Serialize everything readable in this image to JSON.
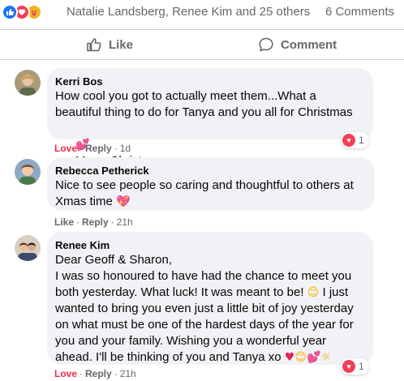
{
  "reactions": {
    "types": [
      "like-icon",
      "love-icon",
      "care-icon"
    ],
    "reactors_text": "Natalie Landsberg, Renee Kim and 25 others",
    "comments_count": "6 Comments"
  },
  "actions": {
    "like_label": "Like",
    "comment_label": "Comment"
  },
  "comments": [
    {
      "author": "Kerri Bos",
      "text": "How cool you got to actually meet them...What a\nbeautiful thing to do for Tanya and you all for Christmas",
      "text_line2": "Merry Christmas",
      "action_1": "Love",
      "action_2": "Reply",
      "time": "1d",
      "reaction_count": "1"
    },
    {
      "author": "Rebecca Petherick",
      "text": "Nice to see people so caring and thoughtful to others at\nXmas time",
      "action_1": "Like",
      "action_2": "Reply",
      "time": "21h"
    },
    {
      "author": "Renee Kim",
      "text_a": "Dear Geoff & Sharon,\nI was so honoured to have had the chance to meet you\nboth yesterday. What luck! It was meant to be!",
      "text_b": " I just\nwanted to bring you even just a little bit of joy yesterday\non what must be one of the hardest days of the year for\nyou and your family. Wishing you a wonderful year\nahead. I'll be thinking of you and Tanya xo ",
      "action_1": "Love",
      "action_2": "Reply",
      "time": "21h",
      "reaction_count": "1"
    }
  ],
  "colors": {
    "accent": "#1877f2",
    "love": "#f33e58",
    "muted": "#65676b",
    "bubble": "#f0f2f5"
  }
}
